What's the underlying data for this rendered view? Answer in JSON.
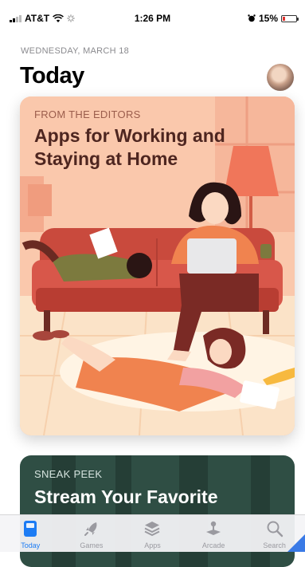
{
  "status_bar": {
    "carrier": "AT&T",
    "time": "1:26 PM",
    "battery": "15%"
  },
  "header": {
    "date": "WEDNESDAY, MARCH 18",
    "title": "Today"
  },
  "cards": [
    {
      "eyebrow": "FROM THE EDITORS",
      "title": "Apps for Working and Staying at Home"
    },
    {
      "eyebrow": "SNEAK PEEK",
      "title": "Stream Your Favorite"
    }
  ],
  "tabs": [
    {
      "label": "Today",
      "icon": "today-icon"
    },
    {
      "label": "Games",
      "icon": "rocket-icon"
    },
    {
      "label": "Apps",
      "icon": "layers-icon"
    },
    {
      "label": "Arcade",
      "icon": "joystick-icon"
    },
    {
      "label": "Search",
      "icon": "search-icon"
    }
  ],
  "colors": {
    "accent": "#1c7cf4",
    "inactive_tab": "#9a9aa0",
    "card1_bg": "#f9c8ac",
    "card2_bg": "#2f4e44"
  }
}
